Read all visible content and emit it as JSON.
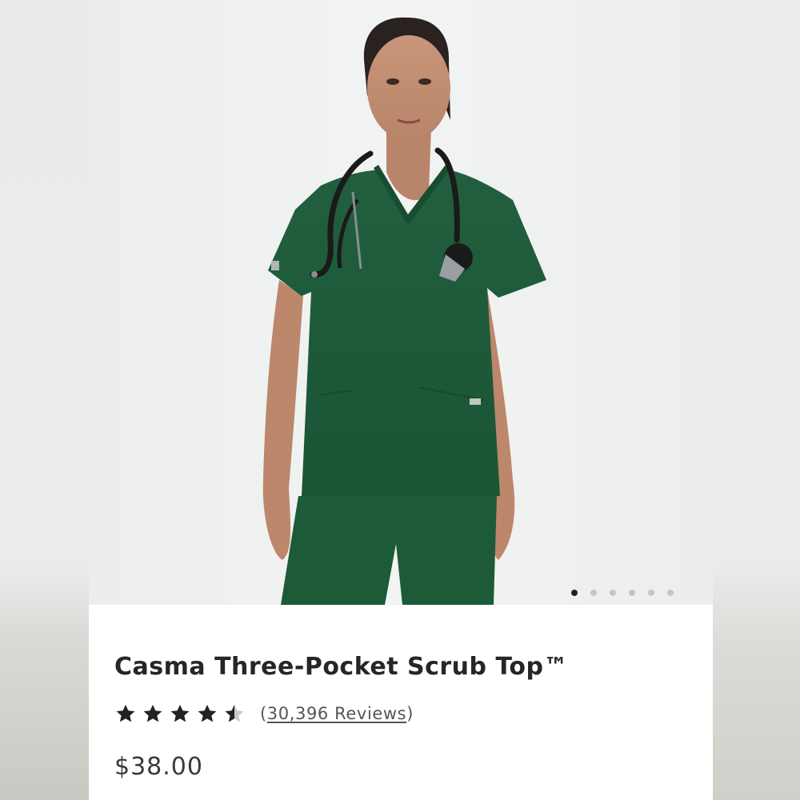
{
  "product": {
    "name": "Casma Three-Pocket Scrub Top™",
    "rating": 4.5,
    "max_rating": 5,
    "review_count": "30,396 Reviews",
    "review_open": "(",
    "review_close": ")",
    "price": "$38.00"
  },
  "gallery": {
    "image_count": 6,
    "active_index": 0,
    "subject": "model wearing hunter green v-neck scrub top with stethoscope"
  },
  "colors": {
    "scrub_green": "#1f5d3b",
    "star": "#222222",
    "star_empty": "#c8c8c8",
    "dot_active": "#222222",
    "dot_inactive": "#c5c5c5"
  },
  "icons": {
    "star": "star-icon",
    "half_star": "half-star-icon"
  }
}
